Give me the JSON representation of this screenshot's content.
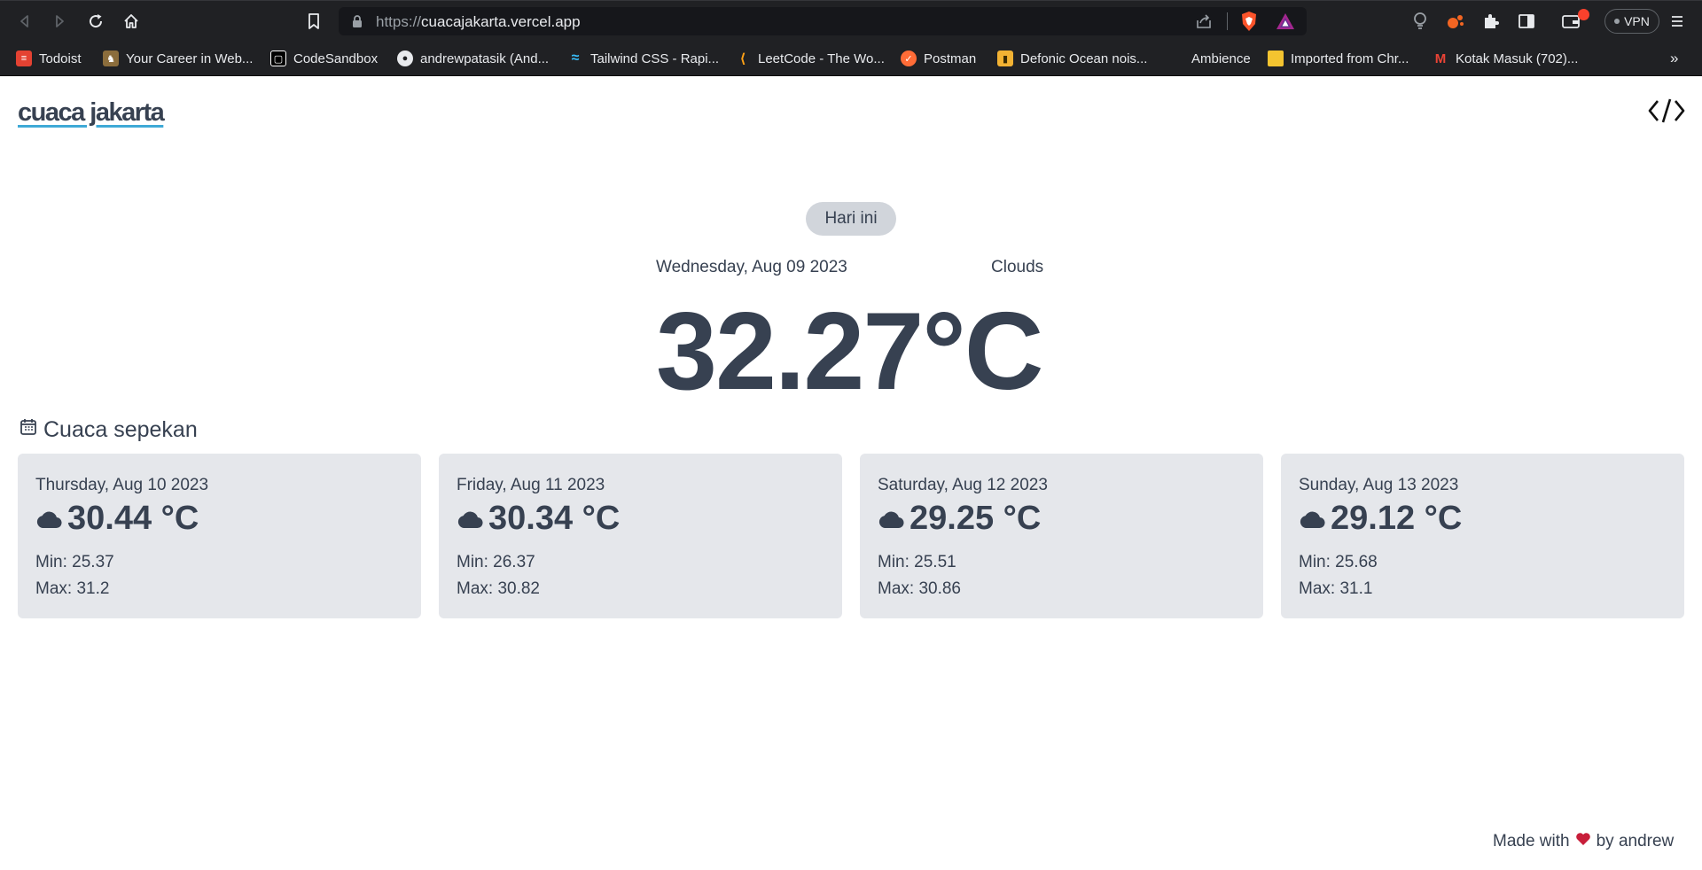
{
  "browser": {
    "url_protocol": "https://",
    "url_host": "cuacajakarta.vercel.app",
    "vpn_label": "VPN",
    "more_label": "»",
    "bookmarks": [
      {
        "label": "Todoist",
        "icon": "todoist-icon",
        "color": "#e44232"
      },
      {
        "label": "Your Career in Web...",
        "icon": "career-icon",
        "color": "#8b6d3c"
      },
      {
        "label": "CodeSandbox",
        "icon": "codesandbox-icon",
        "color": "#000000"
      },
      {
        "label": "andrewpatasik (And...",
        "icon": "github-icon",
        "color": "#24292e"
      },
      {
        "label": "Tailwind CSS - Rapi...",
        "icon": "tailwind-icon",
        "color": "#38bdf8"
      },
      {
        "label": "LeetCode - The Wo...",
        "icon": "leetcode-icon",
        "color": "#ffa116"
      },
      {
        "label": "Postman",
        "icon": "postman-icon",
        "color": "#ff6c37"
      },
      {
        "label": "Defonic Ocean nois...",
        "icon": "defonic-icon",
        "color": "#f2b233"
      },
      {
        "label": "Ambience",
        "icon": "",
        "color": ""
      },
      {
        "label": "Imported from Chr...",
        "icon": "folder-icon",
        "color": "#f4c430"
      },
      {
        "label": "Kotak Masuk (702)...",
        "icon": "gmail-icon",
        "color": "#ea4335"
      }
    ]
  },
  "header": {
    "brand": "cuaca jakarta"
  },
  "today": {
    "badge": "Hari ini",
    "date": "Wednesday, Aug 09 2023",
    "condition": "Clouds",
    "temperature": "32.27°C"
  },
  "week": {
    "title": "Cuaca sepekan",
    "days": [
      {
        "date": "Thursday, Aug 10 2023",
        "temp": "30.44 °C",
        "min": "Min: 25.37",
        "max": "Max: 31.2"
      },
      {
        "date": "Friday, Aug 11 2023",
        "temp": "30.34 °C",
        "min": "Min: 26.37",
        "max": "Max: 30.82"
      },
      {
        "date": "Saturday, Aug 12 2023",
        "temp": "29.25 °C",
        "min": "Min: 25.51",
        "max": "Max: 30.86"
      },
      {
        "date": "Sunday, Aug 13 2023",
        "temp": "29.12 °C",
        "min": "Min: 25.68",
        "max": "Max: 31.1"
      }
    ]
  },
  "footer": {
    "made_with": "Made with",
    "by": "by andrew",
    "heart_color": "#c81e3a"
  },
  "colors": {
    "text": "#374151",
    "card_bg": "#e5e7eb",
    "badge_bg": "#d1d5db",
    "brand_underline": "#3fa9d6"
  }
}
